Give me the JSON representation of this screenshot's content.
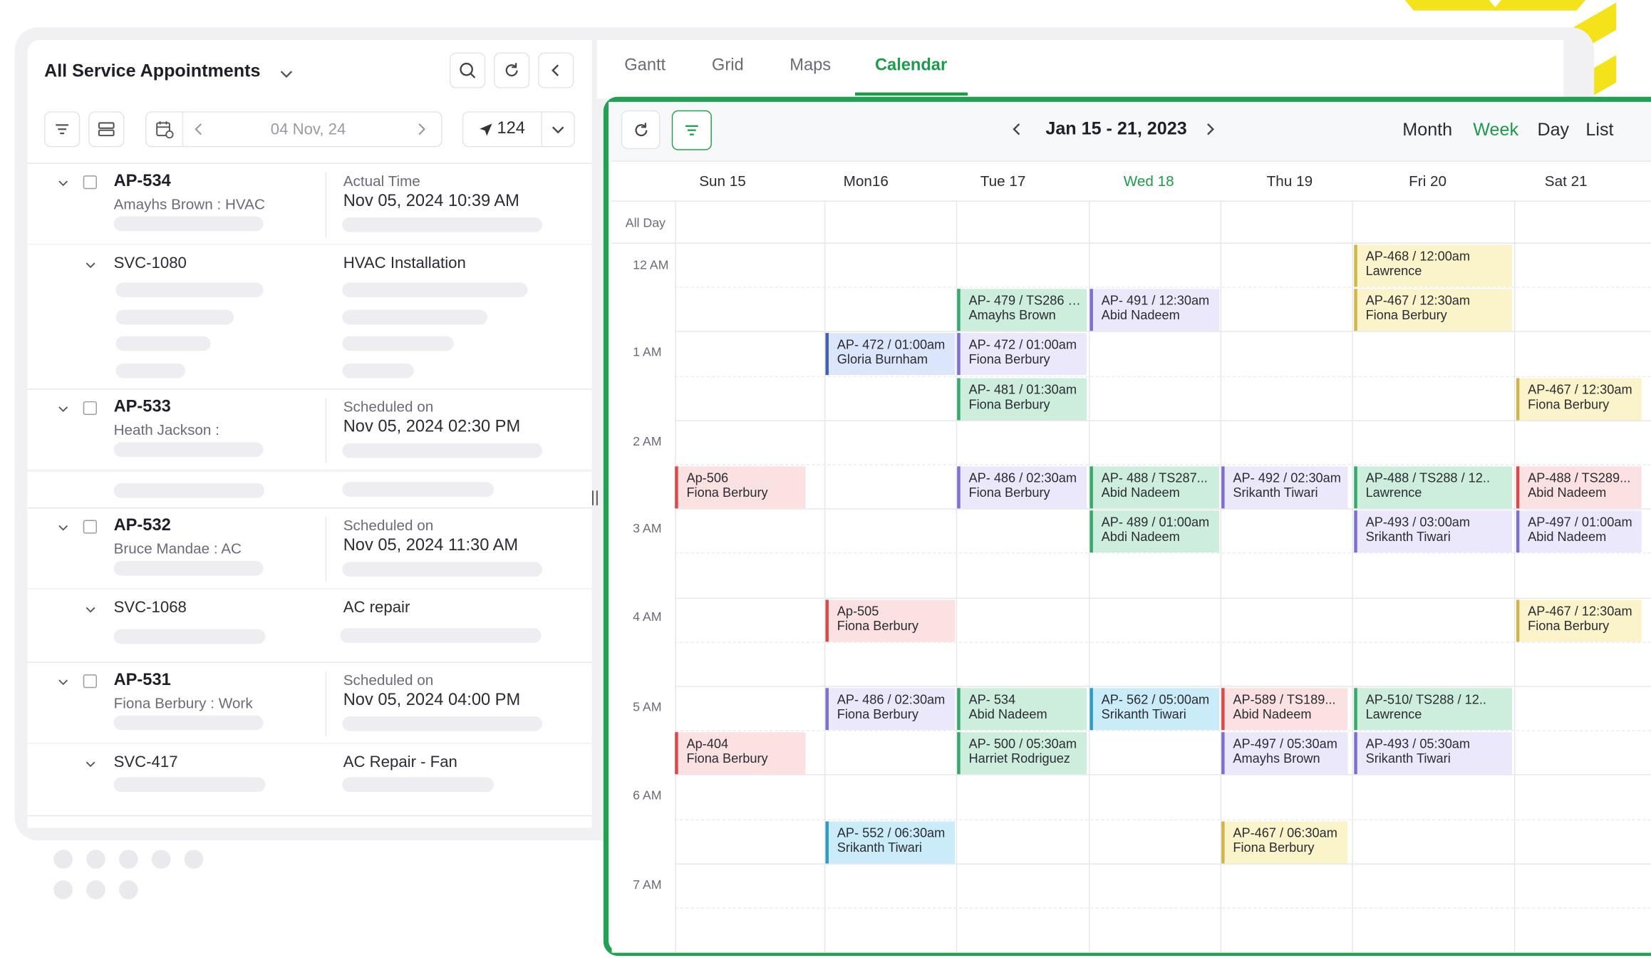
{
  "left_panel": {
    "title": "All Service Appointments",
    "date_value": "04 Nov, 24",
    "dispatch_count": "124",
    "appointments": [
      {
        "id": "AP-534",
        "customer": "Amayhs Brown : HVAC",
        "time_label": "Actual Time",
        "time_value": "Nov 05, 2024 10:39 AM",
        "service": {
          "id": "SVC-1080",
          "name": "HVAC Installation"
        }
      },
      {
        "id": "AP-533",
        "customer": "Heath Jackson :",
        "time_label": "Scheduled on",
        "time_value": "Nov 05, 2024 02:30 PM"
      },
      {
        "id": "AP-532",
        "customer": "Bruce Mandae : AC",
        "time_label": "Scheduled on",
        "time_value": "Nov 05, 2024 11:30 AM",
        "service": {
          "id": "SVC-1068",
          "name": "AC repair"
        }
      },
      {
        "id": "AP-531",
        "customer": "Fiona Berbury : Work",
        "time_label": "Scheduled on",
        "time_value": "Nov 05, 2024 04:00 PM",
        "service": {
          "id": "SVC-417",
          "name": "AC Repair - Fan"
        }
      }
    ]
  },
  "view_tabs": [
    {
      "label": "Gantt",
      "active": false
    },
    {
      "label": "Grid",
      "active": false
    },
    {
      "label": "Maps",
      "active": false
    },
    {
      "label": "Calendar",
      "active": true
    }
  ],
  "calendar": {
    "range": "Jan 15 - 21, 2023",
    "modes": [
      "Month",
      "Week",
      "Day",
      "List"
    ],
    "active_mode": "Week",
    "all_day_label": "All Day",
    "days": [
      "Sun 15",
      "Mon16",
      "Tue 17",
      "Wed 18",
      "Thu 19",
      "Fri 20",
      "Sat 21"
    ],
    "today_index": 3,
    "time_labels": [
      "12 AM",
      "1 AM",
      "2 AM",
      "3 AM",
      "4 AM",
      "5 AM",
      "6 AM",
      "7 AM"
    ],
    "events": [
      {
        "day": 5,
        "slot": 0,
        "l1": "AP-468 / 12:00am",
        "l2": "Lawrence",
        "color": "yellow"
      },
      {
        "day": 2,
        "slot": 1,
        "l1": "AP- 479 / TS286 / ...",
        "l2": "Amayhs Brown",
        "color": "green"
      },
      {
        "day": 3,
        "slot": 1,
        "l1": "AP- 491 / 12:30am",
        "l2": "Abid Nadeem",
        "color": "purple"
      },
      {
        "day": 5,
        "slot": 1,
        "l1": "AP-467 / 12:30am",
        "l2": "Fiona Berbury",
        "color": "yellow"
      },
      {
        "day": 1,
        "slot": 2,
        "l1": "AP- 472 / 01:00am",
        "l2": "Gloria Burnham",
        "color": "blue"
      },
      {
        "day": 2,
        "slot": 2,
        "l1": "AP- 472 / 01:00am",
        "l2": "Fiona Berbury",
        "color": "purple"
      },
      {
        "day": 2,
        "slot": 3,
        "l1": "AP- 481 / 01:30am",
        "l2": "Fiona Berbury",
        "color": "green"
      },
      {
        "day": 6,
        "slot": 3,
        "l1": "AP-467 / 12:30am",
        "l2": "Fiona Berbury",
        "color": "yellow"
      },
      {
        "day": 0,
        "slot": 5,
        "l1": "Ap-506",
        "l2": "Fiona Berbury",
        "color": "red"
      },
      {
        "day": 2,
        "slot": 5,
        "l1": "AP- 486 / 02:30am",
        "l2": "Fiona Berbury",
        "color": "purple"
      },
      {
        "day": 3,
        "slot": 5,
        "l1": "AP- 488 / TS287...",
        "l2": "Abid Nadeem",
        "color": "green"
      },
      {
        "day": 4,
        "slot": 5,
        "l1": "AP- 492 / 02:30am",
        "l2": "Srikanth Tiwari",
        "color": "purple"
      },
      {
        "day": 5,
        "slot": 5,
        "l1": "AP-488 / TS288 / 12..",
        "l2": "Lawrence",
        "color": "green"
      },
      {
        "day": 6,
        "slot": 5,
        "l1": "AP-488 / TS289...",
        "l2": "Abid Nadeem",
        "color": "red"
      },
      {
        "day": 3,
        "slot": 6,
        "l1": "AP- 489 / 01:00am",
        "l2": "Abdi Nadeem",
        "color": "green"
      },
      {
        "day": 5,
        "slot": 6,
        "l1": "AP-493 / 03:00am",
        "l2": "Srikanth Tiwari",
        "color": "purple"
      },
      {
        "day": 6,
        "slot": 6,
        "l1": "AP-497 / 01:00am",
        "l2": "Abid Nadeem",
        "color": "purple"
      },
      {
        "day": 1,
        "slot": 8,
        "l1": "Ap-505",
        "l2": "Fiona Berbury",
        "color": "red"
      },
      {
        "day": 6,
        "slot": 8,
        "l1": "AP-467 / 12:30am",
        "l2": "Fiona Berbury",
        "color": "yellow"
      },
      {
        "day": 1,
        "slot": 10,
        "l1": "AP- 486 / 02:30am",
        "l2": "Fiona Berbury",
        "color": "purple"
      },
      {
        "day": 2,
        "slot": 10,
        "l1": "AP- 534",
        "l2": "Abid Nadeem",
        "color": "green"
      },
      {
        "day": 3,
        "slot": 10,
        "l1": "AP- 562 / 05:00am",
        "l2": "Srikanth Tiwari",
        "color": "cyan"
      },
      {
        "day": 4,
        "slot": 10,
        "l1": "AP-589 / TS189...",
        "l2": "Abid Nadeem",
        "color": "red"
      },
      {
        "day": 5,
        "slot": 10,
        "l1": "AP-510/ TS288 / 12..",
        "l2": "Lawrence",
        "color": "green"
      },
      {
        "day": 0,
        "slot": 11,
        "l1": "Ap-404",
        "l2": "Fiona Berbury",
        "color": "red"
      },
      {
        "day": 2,
        "slot": 11,
        "l1": "AP- 500 / 05:30am",
        "l2": "Harriet Rodriguez",
        "color": "green"
      },
      {
        "day": 4,
        "slot": 11,
        "l1": "AP-497 / 05:30am",
        "l2": "Amayhs Brown",
        "color": "purple"
      },
      {
        "day": 5,
        "slot": 11,
        "l1": "AP-493 / 05:30am",
        "l2": "Srikanth Tiwari",
        "color": "purple"
      },
      {
        "day": 1,
        "slot": 13,
        "l1": "AP- 552 / 06:30am",
        "l2": "Srikanth Tiwari",
        "color": "cyan"
      },
      {
        "day": 4,
        "slot": 13,
        "l1": "AP-467 / 06:30am",
        "l2": "Fiona Berbury",
        "color": "yellow"
      }
    ]
  },
  "colors": {
    "accent": "#1e9a4c",
    "event_palette": {
      "yellow": {
        "bg": "#fbf3c9",
        "bar": "#cfb54a"
      },
      "green": {
        "bg": "#cdeedc",
        "bar": "#37a86a"
      },
      "purple": {
        "bg": "#ebe8fb",
        "bar": "#7b6fcf"
      },
      "blue": {
        "bg": "#dbe5fb",
        "bar": "#3e5fb8"
      },
      "red": {
        "bg": "#fbe1e1",
        "bar": "#d94a4a"
      },
      "cyan": {
        "bg": "#c9ecf8",
        "bar": "#2e9bc3"
      }
    }
  }
}
